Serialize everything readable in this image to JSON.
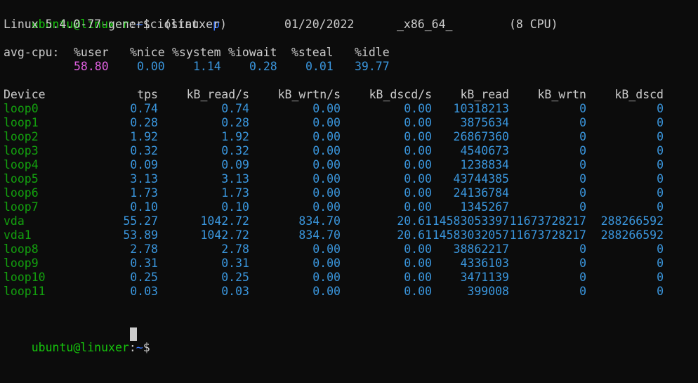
{
  "prompt": {
    "user_host": "ubuntu@linuxer",
    "sep": ":",
    "path": "~",
    "symbol": "$"
  },
  "command": {
    "name": "iostat",
    "flag": "-p"
  },
  "sysinfo": {
    "kernel": "Linux 5.4.0-77-generic (linuxer)",
    "date": "01/20/2022",
    "arch": "_x86_64_",
    "cpus": "(8 CPU)"
  },
  "cpu": {
    "label": "avg-cpu:",
    "headers": [
      "%user",
      "%nice",
      "%system",
      "%iowait",
      "%steal",
      "%idle"
    ],
    "values": [
      "58.80",
      "0.00",
      "1.14",
      "0.28",
      "0.01",
      "39.77"
    ]
  },
  "table": {
    "headers": [
      "Device",
      "tps",
      "kB_read/s",
      "kB_wrtn/s",
      "kB_dscd/s",
      "kB_read",
      "kB_wrtn",
      "kB_dscd"
    ],
    "rows": [
      [
        "loop0",
        "0.74",
        "0.74",
        "0.00",
        "0.00",
        "10318213",
        "0",
        "0"
      ],
      [
        "loop1",
        "0.28",
        "0.28",
        "0.00",
        "0.00",
        "3875634",
        "0",
        "0"
      ],
      [
        "loop2",
        "1.92",
        "1.92",
        "0.00",
        "0.00",
        "26867360",
        "0",
        "0"
      ],
      [
        "loop3",
        "0.32",
        "0.32",
        "0.00",
        "0.00",
        "4540673",
        "0",
        "0"
      ],
      [
        "loop4",
        "0.09",
        "0.09",
        "0.00",
        "0.00",
        "1238834",
        "0",
        "0"
      ],
      [
        "loop5",
        "3.13",
        "3.13",
        "0.00",
        "0.00",
        "43744385",
        "0",
        "0"
      ],
      [
        "loop6",
        "1.73",
        "1.73",
        "0.00",
        "0.00",
        "24136784",
        "0",
        "0"
      ],
      [
        "loop7",
        "0.10",
        "0.10",
        "0.00",
        "0.00",
        "1345267",
        "0",
        "0"
      ],
      [
        "vda",
        "55.27",
        "1042.72",
        "834.70",
        "20.61",
        "14583053397",
        "11673728217",
        "288266592"
      ],
      [
        "vda1",
        "53.89",
        "1042.72",
        "834.70",
        "20.61",
        "14583032057",
        "11673728217",
        "288266592"
      ],
      [
        "loop8",
        "2.78",
        "2.78",
        "0.00",
        "0.00",
        "38862217",
        "0",
        "0"
      ],
      [
        "loop9",
        "0.31",
        "0.31",
        "0.00",
        "0.00",
        "4336103",
        "0",
        "0"
      ],
      [
        "loop10",
        "0.25",
        "0.25",
        "0.00",
        "0.00",
        "3471139",
        "0",
        "0"
      ],
      [
        "loop11",
        "0.03",
        "0.03",
        "0.00",
        "0.00",
        "399008",
        "0",
        "0"
      ]
    ]
  }
}
